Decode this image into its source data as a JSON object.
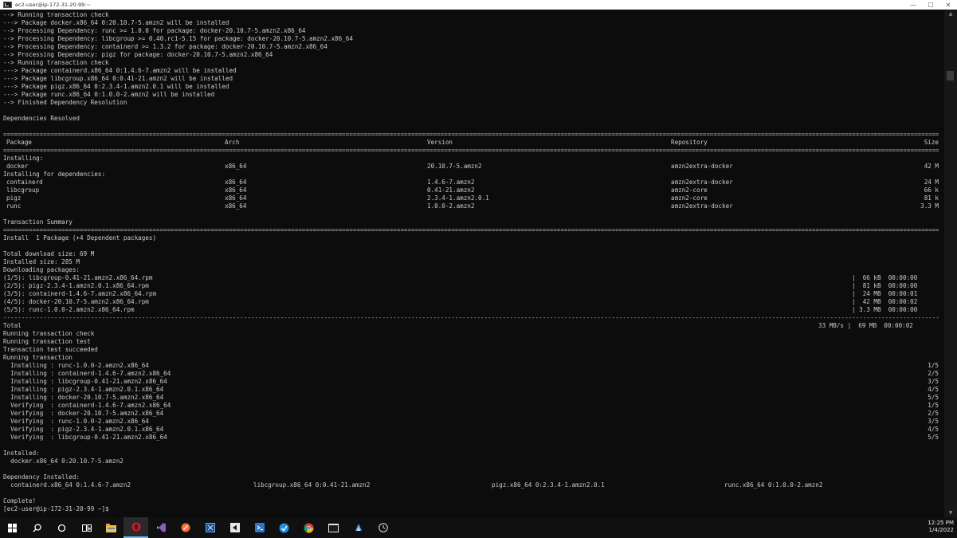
{
  "window": {
    "title": "ec2-user@ip-172-31-20-99:~",
    "minimize": "—",
    "maximize": "☐",
    "close": "✕"
  },
  "terminal": {
    "pre_lines": [
      "--> Running transaction check",
      "---> Package docker.x86_64 0:20.10.7-5.amzn2 will be installed",
      "--> Processing Dependency: runc >= 1.0.0 for package: docker-20.10.7-5.amzn2.x86_64",
      "--> Processing Dependency: libcgroup >= 0.40.rc1-5.15 for package: docker-20.10.7-5.amzn2.x86_64",
      "--> Processing Dependency: containerd >= 1.3.2 for package: docker-20.10.7-5.amzn2.x86_64",
      "--> Processing Dependency: pigz for package: docker-20.10.7-5.amzn2.x86_64",
      "--> Running transaction check",
      "---> Package containerd.x86_64 0:1.4.6-7.amzn2 will be installed",
      "---> Package libcgroup.x86_64 0:0.41-21.amzn2 will be installed",
      "---> Package pigz.x86_64 0:2.3.4-1.amzn2.0.1 will be installed",
      "---> Package runc.x86_64 0:1.0.0-2.amzn2 will be installed",
      "--> Finished Dependency Resolution"
    ],
    "deps_resolved": "Dependencies Resolved",
    "table": {
      "headers": {
        "package": "Package",
        "arch": "Arch",
        "version": "Version",
        "repository": "Repository",
        "size": "Size"
      },
      "installing_label": "Installing:",
      "main": {
        "package": "docker",
        "arch": "x86_64",
        "version": "20.10.7-5.amzn2",
        "repository": "amzn2extra-docker",
        "size": "42 M"
      },
      "deps_label": "Installing for dependencies:",
      "deps": [
        {
          "package": "containerd",
          "arch": "x86_64",
          "version": "1.4.6-7.amzn2",
          "repository": "amzn2extra-docker",
          "size": "24 M"
        },
        {
          "package": "libcgroup",
          "arch": "x86_64",
          "version": "0.41-21.amzn2",
          "repository": "amzn2-core",
          "size": "66 k"
        },
        {
          "package": "pigz",
          "arch": "x86_64",
          "version": "2.3.4-1.amzn2.0.1",
          "repository": "amzn2-core",
          "size": "81 k"
        },
        {
          "package": "runc",
          "arch": "x86_64",
          "version": "1.0.0-2.amzn2",
          "repository": "amzn2extra-docker",
          "size": "3.3 M"
        }
      ]
    },
    "transaction_summary": "Transaction Summary",
    "install_summary": "Install  1 Package (+4 Dependent packages)",
    "total_download": "Total download size: 69 M",
    "installed_size": "Installed size: 285 M",
    "downloading": "Downloading packages:",
    "downloads": [
      {
        "name": "(1/5): libcgroup-0.41-21.amzn2.x86_64.rpm",
        "stat": "|  66 kB  00:00:00"
      },
      {
        "name": "(2/5): pigz-2.3.4-1.amzn2.0.1.x86_64.rpm",
        "stat": "|  81 kB  00:00:00"
      },
      {
        "name": "(3/5): containerd-1.4.6-7.amzn2.x86_64.rpm",
        "stat": "|  24 MB  00:00:01"
      },
      {
        "name": "(4/5): docker-20.10.7-5.amzn2.x86_64.rpm",
        "stat": "|  42 MB  00:00:02"
      },
      {
        "name": "(5/5): runc-1.0.0-2.amzn2.x86_64.rpm",
        "stat": "| 3.3 MB  00:00:00"
      }
    ],
    "total_label": "Total",
    "total_stat": "33 MB/s |  69 MB  00:00:02",
    "trans_lines": [
      "Running transaction check",
      "Running transaction test",
      "Transaction test succeeded",
      "Running transaction"
    ],
    "steps": [
      {
        "text": "  Installing : runc-1.0.0-2.amzn2.x86_64",
        "count": "1/5"
      },
      {
        "text": "  Installing : containerd-1.4.6-7.amzn2.x86_64",
        "count": "2/5"
      },
      {
        "text": "  Installing : libcgroup-0.41-21.amzn2.x86_64",
        "count": "3/5"
      },
      {
        "text": "  Installing : pigz-2.3.4-1.amzn2.0.1.x86_64",
        "count": "4/5"
      },
      {
        "text": "  Installing : docker-20.10.7-5.amzn2.x86_64",
        "count": "5/5"
      },
      {
        "text": "  Verifying  : containerd-1.4.6-7.amzn2.x86_64",
        "count": "1/5"
      },
      {
        "text": "  Verifying  : docker-20.10.7-5.amzn2.x86_64",
        "count": "2/5"
      },
      {
        "text": "  Verifying  : runc-1.0.0-2.amzn2.x86_64",
        "count": "3/5"
      },
      {
        "text": "  Verifying  : pigz-2.3.4-1.amzn2.0.1.x86_64",
        "count": "4/5"
      },
      {
        "text": "  Verifying  : libcgroup-0.41-21.amzn2.x86_64",
        "count": "5/5"
      }
    ],
    "installed_label": "Installed:",
    "installed_item": "  docker.x86_64 0:20.10.7-5.amzn2",
    "dep_installed_label": "Dependency Installed:",
    "dep_installed": [
      "  containerd.x86_64 0:1.4.6-7.amzn2",
      "libcgroup.x86_64 0:0.41-21.amzn2",
      "pigz.x86_64 0:2.3.4-1.amzn2.0.1",
      "runc.x86_64 0:1.0.0-2.amzn2"
    ],
    "complete": "Complete!",
    "prompt": "[ec2-user@ip-172-31-20-99 ~]$ "
  },
  "taskbar": {
    "apps": [
      "start-icon",
      "search-icon",
      "cortana-icon",
      "task-view-icon",
      "file-explorer-icon",
      "opera-icon",
      "visual-studio-icon",
      "postman-icon",
      "remote-desktop-icon",
      "sourcetree-icon",
      "visual-studio-code-icon",
      "vpn-icon",
      "chrome-icon",
      "terminal-icon",
      "app-icon",
      "app-circle-icon"
    ],
    "time": "12:25 PM",
    "date": "1/4/2022"
  },
  "colors": {
    "background": "#0c0c0c",
    "text": "#cccccc",
    "taskbar": "#101010",
    "titlebar": "#ffffff"
  }
}
